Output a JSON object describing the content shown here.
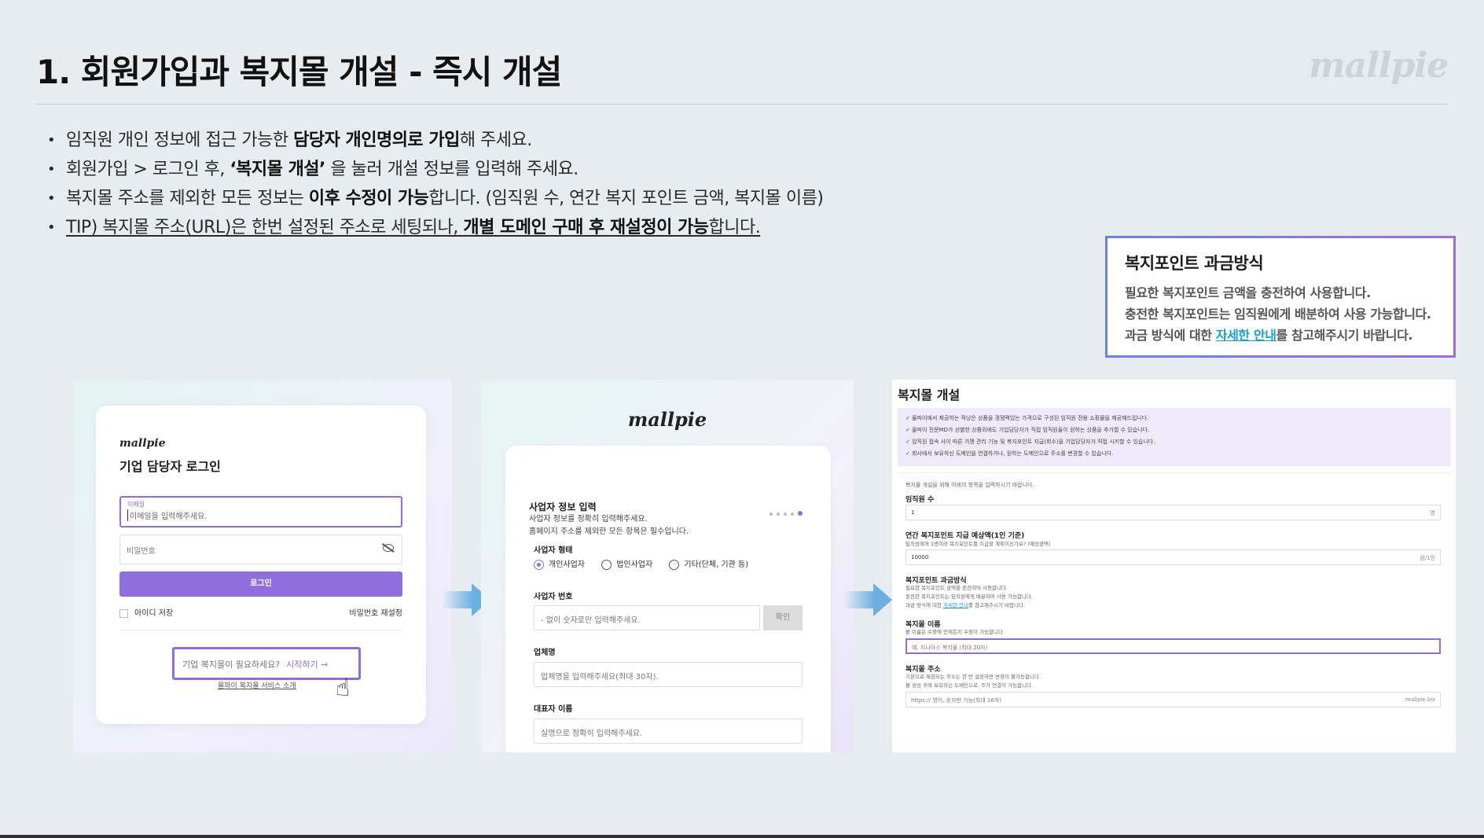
{
  "slide": {
    "title": "1. 회원가입과 복지몰 개설 - 즉시 개설",
    "brand": "mallpie"
  },
  "bullets": [
    {
      "pre": "임직원 개인 정보에 접근 가능한 ",
      "bold": "담당자 개인명의로 가입",
      "post": "해 주세요."
    },
    {
      "pre": "회원가입 > 로그인 후, ",
      "bold": "‘복지몰 개설’",
      "post": " 을 눌러 개설 정보를 입력해 주세요."
    },
    {
      "pre": "복지몰 주소를 제외한 모든 정보는 ",
      "bold": "이후 수정이 가능",
      "post": "합니다. (임직원 수, 연간 복지 포인트 금액, 복지몰 이름)"
    },
    {
      "pre": "TIP) 복지몰 주소(URL)은 한번 설정된 주소로 세팅되나, ",
      "bold": "개별 도메인 구매 후 재설정이 가능",
      "post": "합니다."
    }
  ],
  "infobox": {
    "title": "복지포인트 과금방식",
    "line1": "필요한 복지포인트 금액을 충전하여 사용합니다.",
    "line2": "충전한 복지포인트는 임직원에게 배분하여 사용 가능합니다.",
    "line3_pre": "과금 방식에 대한 ",
    "line3_link": "자세한 안내",
    "line3_post": "를 참고해주시기 바랍니다."
  },
  "login": {
    "logo": "mallpie",
    "title": "기업 담당자 로그인",
    "email_label": "이메일",
    "email_placeholder": "이메일을 입력해주세요.",
    "password_placeholder": "비밀번호",
    "login_button": "로그인",
    "remember_id": "아이디 저장",
    "reset_password": "비밀번호 재설정",
    "cta_text": "기업 복지몰이 필요하세요?",
    "cta_start": "시작하기 →",
    "service_intro": "몰파이 복지몰 서비스 소개"
  },
  "business": {
    "logo": "mallpie",
    "heading": "사업자 정보 입력",
    "desc1": "사업자 정보를 정확히 입력해주세요.",
    "desc2": "홈페이지 주소를 제외한 모든 항목은 필수입니다.",
    "type_label": "사업자 형태",
    "type_options": [
      "개인사업자",
      "법인사업자",
      "기타(단체, 기관 등)"
    ],
    "number_label": "사업자 번호",
    "number_placeholder": "- 없이 숫자로만 입력해주세요.",
    "confirm_button": "확인",
    "company_label": "업체명",
    "company_placeholder": "업체명을 입력해주세요(최대 30자).",
    "ceo_label": "대표자 이름",
    "ceo_placeholder": "실명으로 정확히 입력해주세요."
  },
  "mall_open": {
    "title": "복지몰 개설",
    "notes": [
      "몰파이에서 제공하는 적낭은 상품을 경쟁력있는 가격으로 구성된 임직원 전용 쇼핑몰을 제공해드립니다.",
      "몰파이 전문MD가 선별한 상품외에도 기업담당자가 직접 임직원들이 원하는 상품을 추가할 수 있습니다.",
      "임직원 접속 사이 따른 가맹 관리 기능 및 복지포인트 지급(회수)을 기업담당자가 직접 시키할 수 있습니다.",
      "회사에서 보유하신 도메인을 연결하거나, 원하는 도메인으로 주소를 변경할 수 있습니다."
    ],
    "form_hint": "복지몰 개설을 위해 아래의 항목을 입력하시기 바랍니다.",
    "employees_label": "임직원 수",
    "employees_value": "1",
    "employees_unit": "명",
    "points_label": "연간 복지포인트 지급 예상액(1인 기준)",
    "points_hint": "임직원에게 1명이라 복지포인트를 지급할 계획이신가요? (예상금액)",
    "points_value": "10000",
    "points_unit": "원/1인",
    "billing_label": "복지포인트 과금방식",
    "billing_line1": "필요한 복지포인트 금액을 충전하여 사용합니다.",
    "billing_line2": "충전한 복지포인트는 임직원에게 배분하여 사용 가능합니다.",
    "billing_line3_pre": "과금 방식에 대한 ",
    "billing_line3_link": "자세한 안내",
    "billing_line3_post": "를 참고해주시기 바랍니다.",
    "name_label": "복지몰 이름",
    "name_hint": "몰 이름은 수중에 언제든지 수정이 가능합니다.",
    "name_placeholder": "예. 지니아스 복지몰 (최대 20자)",
    "address_label": "복지몰 주소",
    "address_hint1": "기본으로 제공되는 주소는 한 번 설정하면 변경이 불가능합니다.",
    "address_hint2": "몰 생성 후에 보유하신 도메인으로, 주가 연결이 가능합니다.",
    "address_prefix": "https://  영어, 숫자만 가능(최대 16자)",
    "address_suffix": ".mallpie.biz"
  },
  "colors": {
    "accent": "#8e6fdd",
    "link": "#1aa0c8",
    "arrow": "#6bb0e1",
    "background": "#e6ecef"
  }
}
